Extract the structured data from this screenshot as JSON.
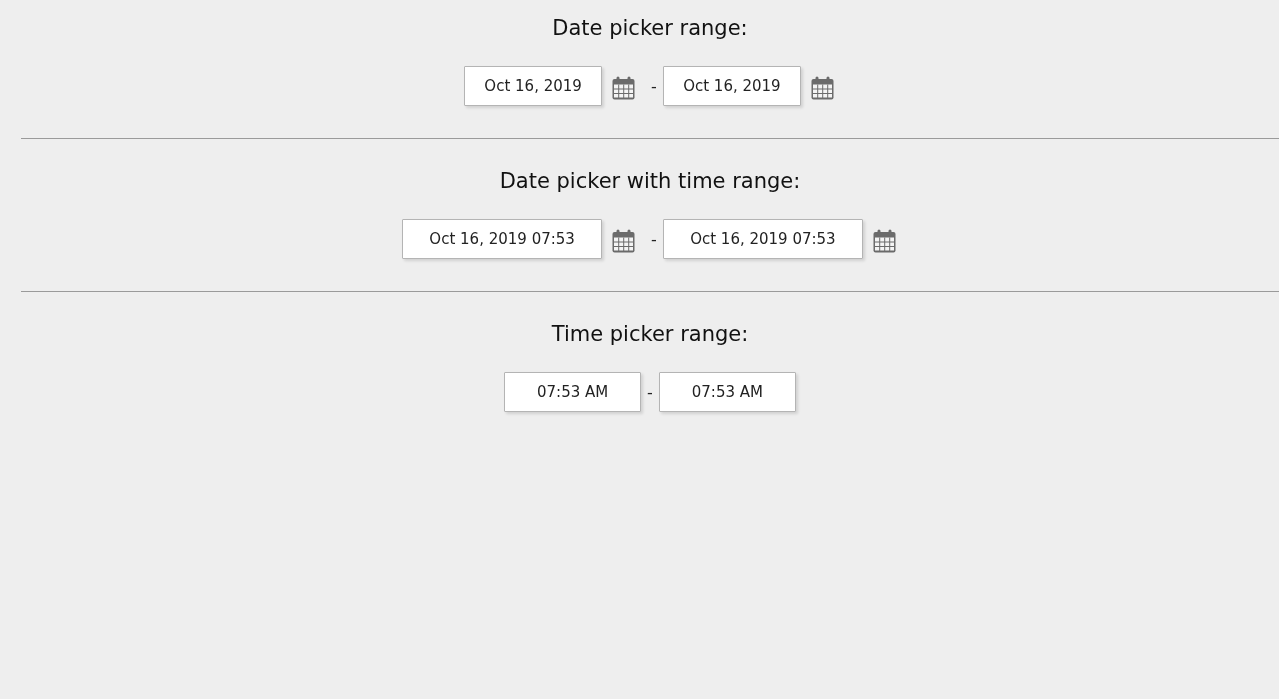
{
  "sections": [
    {
      "title": "Date picker range:",
      "kind": "date",
      "separator": "-",
      "fields": [
        {
          "value": "Oct 16, 2019"
        },
        {
          "value": "Oct 16, 2019"
        }
      ]
    },
    {
      "title": "Date picker with time range:",
      "kind": "datetime",
      "separator": "-",
      "fields": [
        {
          "value": "Oct 16, 2019 07:53"
        },
        {
          "value": "Oct 16, 2019 07:53"
        }
      ]
    },
    {
      "title": "Time picker range:",
      "kind": "time",
      "separator": "-",
      "fields": [
        {
          "value": "07:53 AM"
        },
        {
          "value": "07:53 AM"
        }
      ]
    }
  ]
}
